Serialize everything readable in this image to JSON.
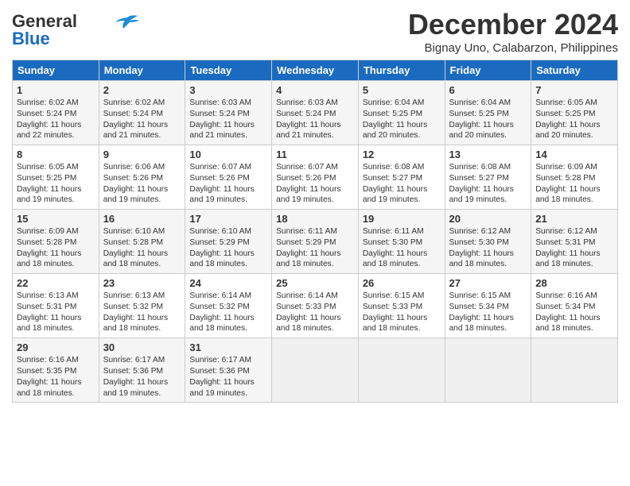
{
  "logo": {
    "line1": "General",
    "line2": "Blue"
  },
  "title": "December 2024",
  "location": "Bignay Uno, Calabarzon, Philippines",
  "days_of_week": [
    "Sunday",
    "Monday",
    "Tuesday",
    "Wednesday",
    "Thursday",
    "Friday",
    "Saturday"
  ],
  "weeks": [
    [
      {
        "day": "1",
        "text": "Sunrise: 6:02 AM\nSunset: 5:24 PM\nDaylight: 11 hours\nand 22 minutes."
      },
      {
        "day": "2",
        "text": "Sunrise: 6:02 AM\nSunset: 5:24 PM\nDaylight: 11 hours\nand 21 minutes."
      },
      {
        "day": "3",
        "text": "Sunrise: 6:03 AM\nSunset: 5:24 PM\nDaylight: 11 hours\nand 21 minutes."
      },
      {
        "day": "4",
        "text": "Sunrise: 6:03 AM\nSunset: 5:24 PM\nDaylight: 11 hours\nand 21 minutes."
      },
      {
        "day": "5",
        "text": "Sunrise: 6:04 AM\nSunset: 5:25 PM\nDaylight: 11 hours\nand 20 minutes."
      },
      {
        "day": "6",
        "text": "Sunrise: 6:04 AM\nSunset: 5:25 PM\nDaylight: 11 hours\nand 20 minutes."
      },
      {
        "day": "7",
        "text": "Sunrise: 6:05 AM\nSunset: 5:25 PM\nDaylight: 11 hours\nand 20 minutes."
      }
    ],
    [
      {
        "day": "8",
        "text": "Sunrise: 6:05 AM\nSunset: 5:25 PM\nDaylight: 11 hours\nand 19 minutes."
      },
      {
        "day": "9",
        "text": "Sunrise: 6:06 AM\nSunset: 5:26 PM\nDaylight: 11 hours\nand 19 minutes."
      },
      {
        "day": "10",
        "text": "Sunrise: 6:07 AM\nSunset: 5:26 PM\nDaylight: 11 hours\nand 19 minutes."
      },
      {
        "day": "11",
        "text": "Sunrise: 6:07 AM\nSunset: 5:26 PM\nDaylight: 11 hours\nand 19 minutes."
      },
      {
        "day": "12",
        "text": "Sunrise: 6:08 AM\nSunset: 5:27 PM\nDaylight: 11 hours\nand 19 minutes."
      },
      {
        "day": "13",
        "text": "Sunrise: 6:08 AM\nSunset: 5:27 PM\nDaylight: 11 hours\nand 19 minutes."
      },
      {
        "day": "14",
        "text": "Sunrise: 6:09 AM\nSunset: 5:28 PM\nDaylight: 11 hours\nand 18 minutes."
      }
    ],
    [
      {
        "day": "15",
        "text": "Sunrise: 6:09 AM\nSunset: 5:28 PM\nDaylight: 11 hours\nand 18 minutes."
      },
      {
        "day": "16",
        "text": "Sunrise: 6:10 AM\nSunset: 5:28 PM\nDaylight: 11 hours\nand 18 minutes."
      },
      {
        "day": "17",
        "text": "Sunrise: 6:10 AM\nSunset: 5:29 PM\nDaylight: 11 hours\nand 18 minutes."
      },
      {
        "day": "18",
        "text": "Sunrise: 6:11 AM\nSunset: 5:29 PM\nDaylight: 11 hours\nand 18 minutes."
      },
      {
        "day": "19",
        "text": "Sunrise: 6:11 AM\nSunset: 5:30 PM\nDaylight: 11 hours\nand 18 minutes."
      },
      {
        "day": "20",
        "text": "Sunrise: 6:12 AM\nSunset: 5:30 PM\nDaylight: 11 hours\nand 18 minutes."
      },
      {
        "day": "21",
        "text": "Sunrise: 6:12 AM\nSunset: 5:31 PM\nDaylight: 11 hours\nand 18 minutes."
      }
    ],
    [
      {
        "day": "22",
        "text": "Sunrise: 6:13 AM\nSunset: 5:31 PM\nDaylight: 11 hours\nand 18 minutes."
      },
      {
        "day": "23",
        "text": "Sunrise: 6:13 AM\nSunset: 5:32 PM\nDaylight: 11 hours\nand 18 minutes."
      },
      {
        "day": "24",
        "text": "Sunrise: 6:14 AM\nSunset: 5:32 PM\nDaylight: 11 hours\nand 18 minutes."
      },
      {
        "day": "25",
        "text": "Sunrise: 6:14 AM\nSunset: 5:33 PM\nDaylight: 11 hours\nand 18 minutes."
      },
      {
        "day": "26",
        "text": "Sunrise: 6:15 AM\nSunset: 5:33 PM\nDaylight: 11 hours\nand 18 minutes."
      },
      {
        "day": "27",
        "text": "Sunrise: 6:15 AM\nSunset: 5:34 PM\nDaylight: 11 hours\nand 18 minutes."
      },
      {
        "day": "28",
        "text": "Sunrise: 6:16 AM\nSunset: 5:34 PM\nDaylight: 11 hours\nand 18 minutes."
      }
    ],
    [
      {
        "day": "29",
        "text": "Sunrise: 6:16 AM\nSunset: 5:35 PM\nDaylight: 11 hours\nand 18 minutes."
      },
      {
        "day": "30",
        "text": "Sunrise: 6:17 AM\nSunset: 5:36 PM\nDaylight: 11 hours\nand 19 minutes."
      },
      {
        "day": "31",
        "text": "Sunrise: 6:17 AM\nSunset: 5:36 PM\nDaylight: 11 hours\nand 19 minutes."
      },
      {
        "day": "",
        "text": ""
      },
      {
        "day": "",
        "text": ""
      },
      {
        "day": "",
        "text": ""
      },
      {
        "day": "",
        "text": ""
      }
    ]
  ]
}
